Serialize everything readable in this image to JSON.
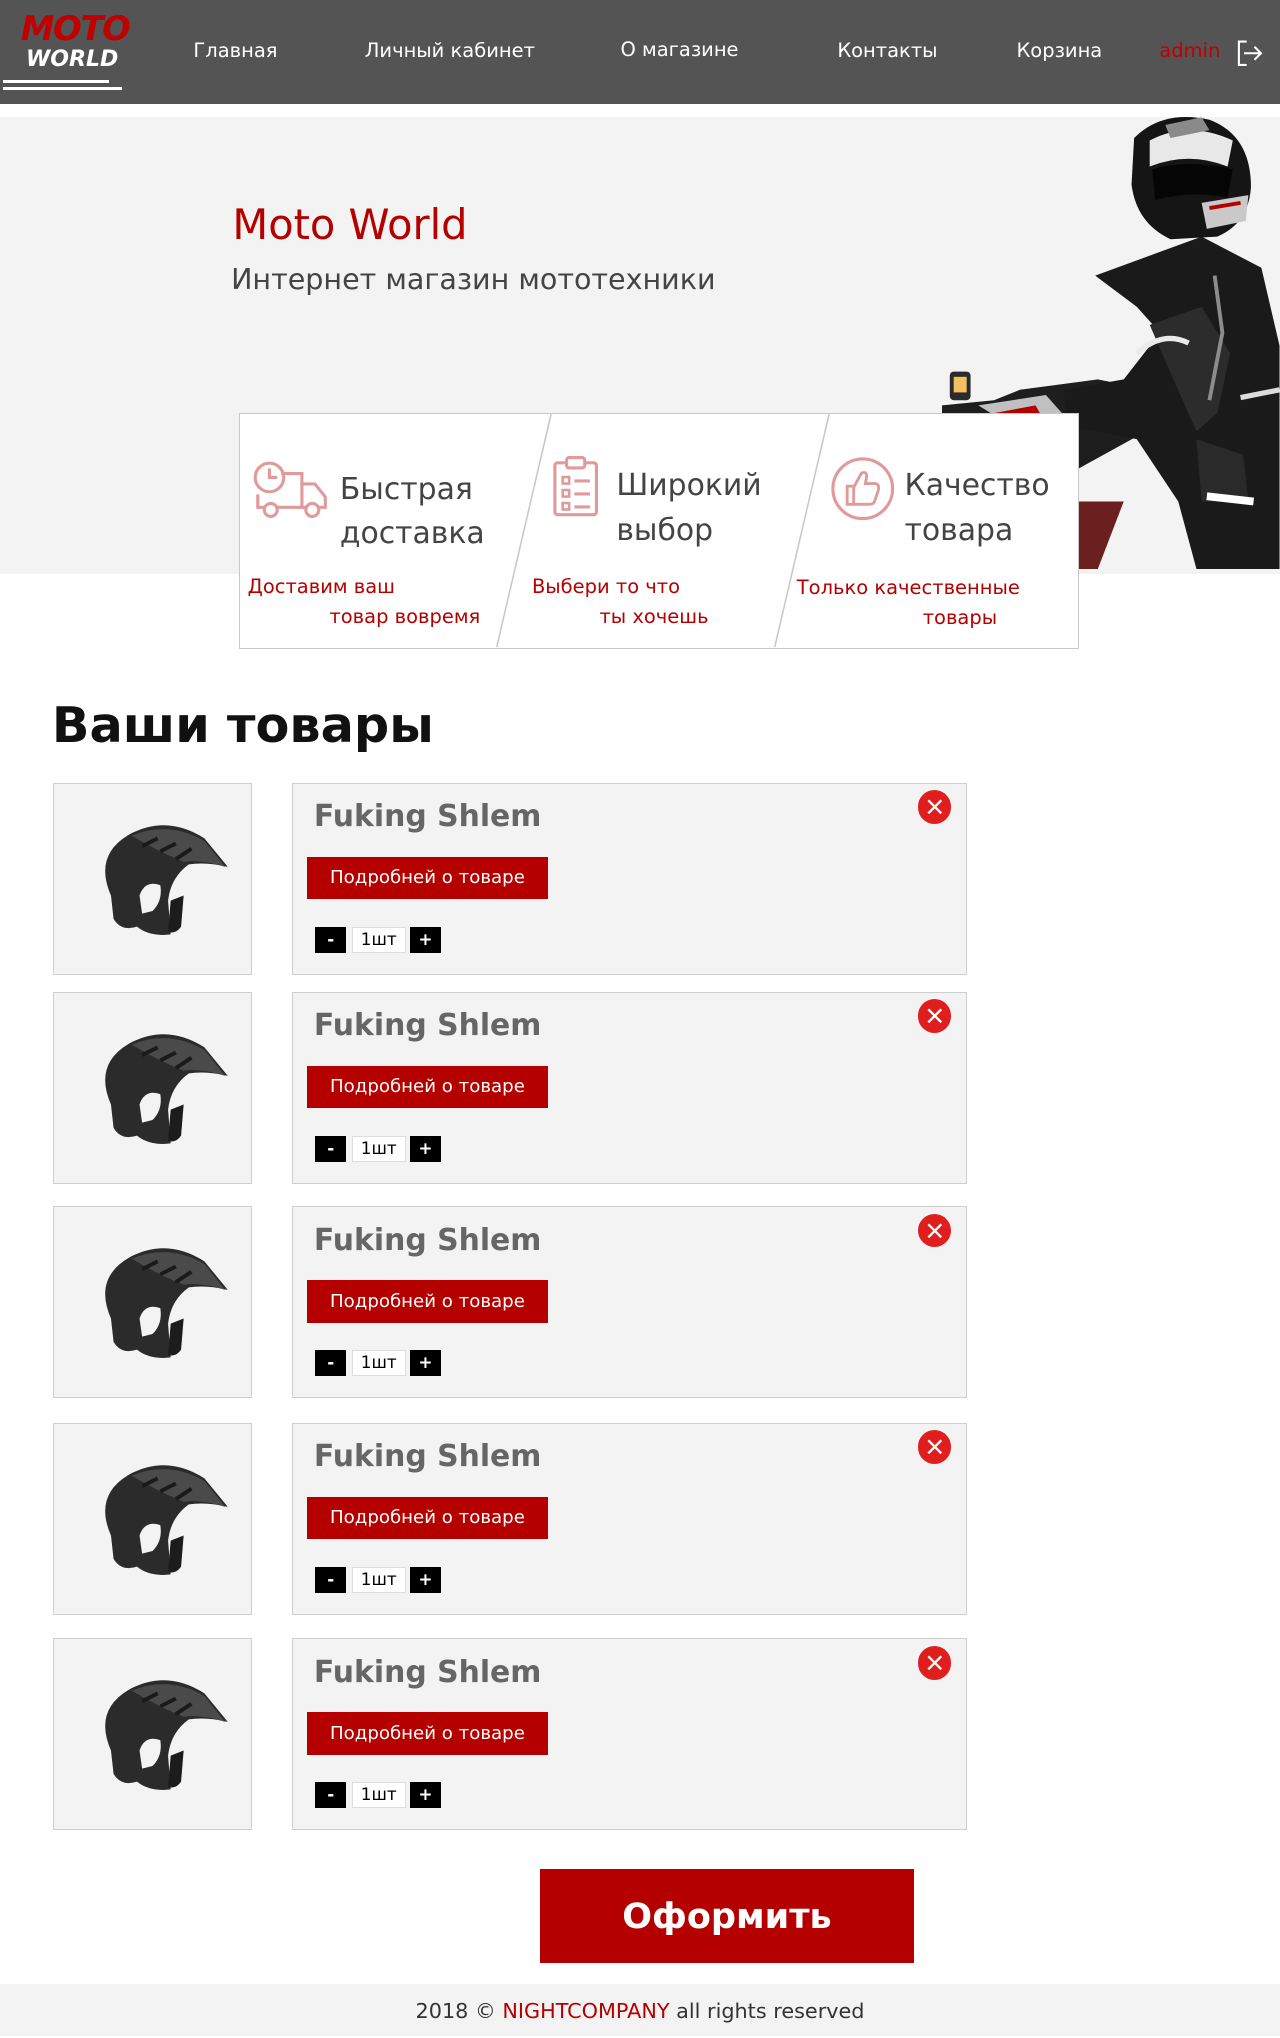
{
  "brand": {
    "line1": "MOTO",
    "line2": "WORLD"
  },
  "nav": {
    "items": [
      "Главная",
      "Личный кабинет",
      "О магазине",
      "Контакты",
      "Корзина"
    ],
    "user": "admin"
  },
  "hero": {
    "title": "Moto World",
    "subtitle": "Интернет магазин мототехники"
  },
  "features": [
    {
      "title1": "Быстрая",
      "title2": "доставка",
      "desc1": "Доставим ваш",
      "desc2": "товар вовремя",
      "icon": "truck-icon"
    },
    {
      "title1": "Широкий",
      "title2": "выбор",
      "desc1": "Выбери то что",
      "desc2": "ты хочешь",
      "icon": "checklist-icon"
    },
    {
      "title1": "Качество",
      "title2": "товара",
      "desc1": "Только качественные",
      "desc2": "товары",
      "icon": "thumbs-up-icon"
    }
  ],
  "cart": {
    "title": "Ваши товары",
    "items": [
      {
        "name": "Fuking Shlem",
        "details_label": "Подробней о товаре",
        "qty": "1шт"
      },
      {
        "name": "Fuking Shlem",
        "details_label": "Подробней о товаре",
        "qty": "1шт"
      },
      {
        "name": "Fuking Shlem",
        "details_label": "Подробней о товаре",
        "qty": "1шт"
      },
      {
        "name": "Fuking Shlem",
        "details_label": "Подробней о товаре",
        "qty": "1шт"
      },
      {
        "name": "Fuking Shlem",
        "details_label": "Подробней о товаре",
        "qty": "1шт"
      }
    ],
    "minus_label": "-",
    "plus_label": "+",
    "checkout_label": "Оформить"
  },
  "footer": {
    "year": "2018 ©",
    "company": "NIGHTCOMPANY",
    "rights": "all rights reserved"
  },
  "colors": {
    "accent": "#b50000",
    "header_bg": "#545454",
    "panel_bg": "#f3f3f3"
  }
}
